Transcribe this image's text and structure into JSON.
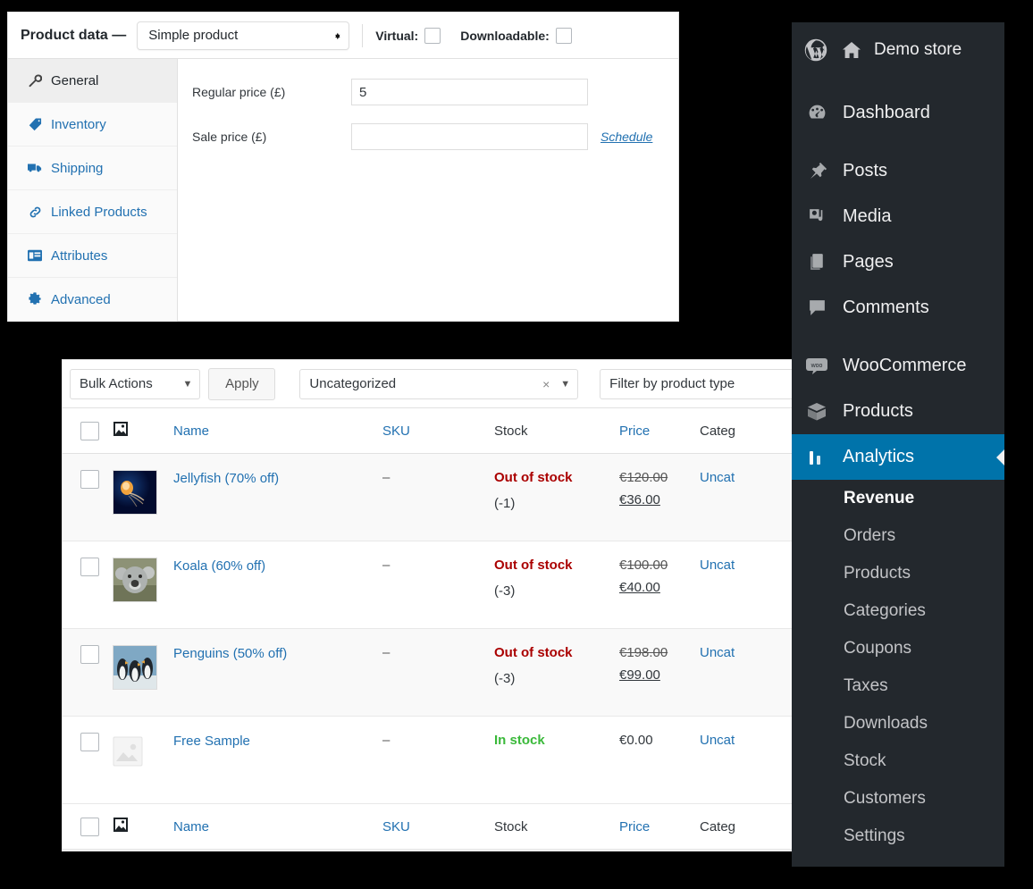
{
  "product_data": {
    "title": "Product data —",
    "type_select": {
      "value": "Simple product",
      "icon": "stepper-icon"
    },
    "virtual": {
      "label": "Virtual:",
      "checked": false
    },
    "downloadable": {
      "label": "Downloadable:",
      "checked": false
    },
    "tabs": [
      {
        "label": "General",
        "icon": "wrench-icon",
        "active": true
      },
      {
        "label": "Inventory",
        "icon": "tag-icon",
        "active": false
      },
      {
        "label": "Shipping",
        "icon": "truck-icon",
        "active": false
      },
      {
        "label": "Linked Products",
        "icon": "link-icon",
        "active": false
      },
      {
        "label": "Attributes",
        "icon": "grid-icon",
        "active": false
      },
      {
        "label": "Advanced",
        "icon": "gear-icon",
        "active": false
      }
    ],
    "fields": [
      {
        "label": "Regular price (£)",
        "value": "5",
        "placeholder": "",
        "link": ""
      },
      {
        "label": "Sale price (£)",
        "value": "",
        "placeholder": "",
        "link": "Schedule"
      }
    ]
  },
  "products_table": {
    "toolbar": {
      "bulk_actions": "Bulk Actions",
      "apply": "Apply",
      "category_filter": "Uncategorized",
      "product_type_filter": "Filter by product type",
      "clear_icon": "close-icon",
      "caret_icon": "chevron-down-icon"
    },
    "columns": [
      "",
      "",
      "Name",
      "SKU",
      "Stock",
      "Price",
      "Categ"
    ],
    "rows": [
      {
        "name": "Jellyfish (70% off)",
        "sku": "–",
        "stock_status": "Out of stock",
        "stock_qty": "(-1)",
        "stock_in": false,
        "price_old": "€120.00",
        "price_new": "€36.00",
        "category": "Uncat",
        "thumb": "jellyfish-thumbnail"
      },
      {
        "name": "Koala (60% off)",
        "sku": "–",
        "stock_status": "Out of stock",
        "stock_qty": "(-3)",
        "stock_in": false,
        "price_old": "€100.00",
        "price_new": "€40.00",
        "category": "Uncat",
        "thumb": "koala-thumbnail"
      },
      {
        "name": "Penguins (50% off)",
        "sku": "–",
        "stock_status": "Out of stock",
        "stock_qty": "(-3)",
        "stock_in": false,
        "price_old": "€198.00",
        "price_new": "€99.00",
        "category": "Uncat",
        "thumb": "penguins-thumbnail"
      },
      {
        "name": "Free Sample",
        "sku": "–",
        "stock_status": "In stock",
        "stock_qty": "",
        "stock_in": true,
        "price_old": "",
        "price_new": "",
        "price_plain": "€0.00",
        "category": "Uncat",
        "thumb": "placeholder-image-icon"
      }
    ]
  },
  "wp_sidebar": {
    "store_name": "Demo store",
    "logo_icon": "wordpress-logo-icon",
    "home_icon": "home-icon",
    "items": [
      {
        "label": "Dashboard",
        "icon": "dashboard-icon",
        "current": false
      },
      {
        "label": "Posts",
        "icon": "pin-icon",
        "current": false
      },
      {
        "label": "Media",
        "icon": "media-icon",
        "current": false
      },
      {
        "label": "Pages",
        "icon": "pages-icon",
        "current": false
      },
      {
        "label": "Comments",
        "icon": "comment-icon",
        "current": false
      },
      {
        "label": "WooCommerce",
        "icon": "woocommerce-icon",
        "current": false
      },
      {
        "label": "Products",
        "icon": "products-icon",
        "current": false
      },
      {
        "label": "Analytics",
        "icon": "analytics-icon",
        "current": true
      }
    ],
    "submenu": [
      {
        "label": "Revenue",
        "current": true
      },
      {
        "label": "Orders",
        "current": false
      },
      {
        "label": "Products",
        "current": false
      },
      {
        "label": "Categories",
        "current": false
      },
      {
        "label": "Coupons",
        "current": false
      },
      {
        "label": "Taxes",
        "current": false
      },
      {
        "label": "Downloads",
        "current": false
      },
      {
        "label": "Stock",
        "current": false
      },
      {
        "label": "Customers",
        "current": false
      },
      {
        "label": "Settings",
        "current": false
      }
    ]
  },
  "colors": {
    "wp_sidebar_bg": "#23282d",
    "wp_current_blue": "#0073aa",
    "link_blue": "#2271b1",
    "out_of_stock_red": "#a00000",
    "in_stock_green": "#3ab93a",
    "page_bg": "#000000"
  }
}
